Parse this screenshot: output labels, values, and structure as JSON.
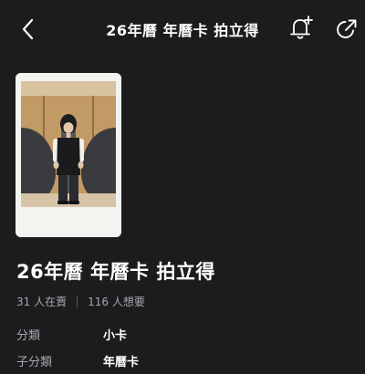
{
  "header": {
    "title": "26年曆 年曆卡 拍立得",
    "back_icon": "chevron-left-icon",
    "notify_icon": "bell-plus-icon",
    "share_icon": "share-arrow-icon"
  },
  "product": {
    "image_icon": "polaroid-photo",
    "title": "26年曆 年曆卡 拍立得",
    "stats": {
      "selling": "31 人在賣",
      "wanting": "116 人想要"
    },
    "attributes": [
      {
        "label": "分類",
        "value": "小卡"
      },
      {
        "label": "子分類",
        "value": "年曆卡"
      }
    ]
  },
  "colors": {
    "background": "#1c1c1e",
    "text_primary": "#ffffff",
    "text_secondary": "#a7a7ad"
  }
}
